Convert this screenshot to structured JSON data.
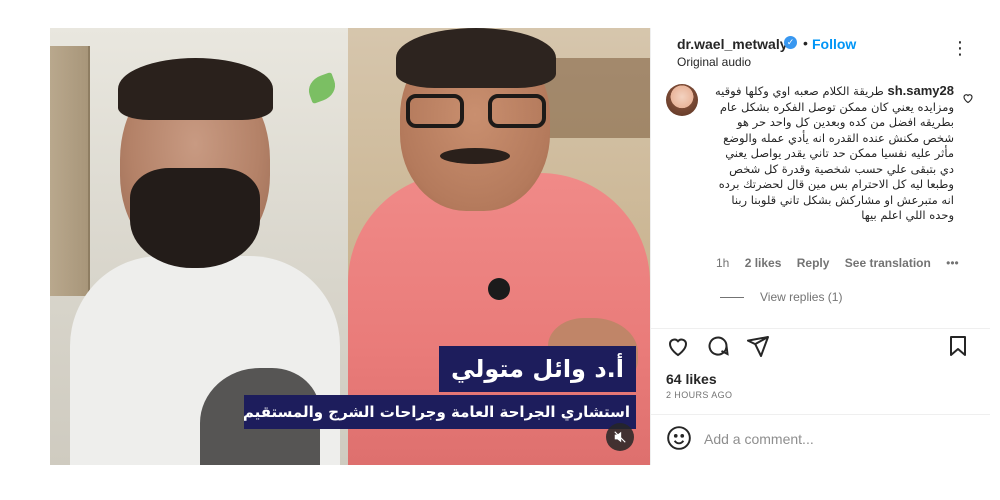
{
  "media": {
    "caption_name": "أ.د وائل متولي",
    "caption_title": "استشاري الجراحة العامة وجراحات الشرج والمستقيم بالليزر",
    "mute_icon": "speaker-muted-icon"
  },
  "header": {
    "username": "dr.wael_metwaly",
    "verified_icon": "verified-badge-icon",
    "separator": "•",
    "follow_label": "Follow",
    "audio_label": "Original audio",
    "more_icon": "more-horizontal-icon",
    "more_glyph": "⋮"
  },
  "comment": {
    "username": "sh.samy28",
    "text": "طريقة الكلام صعبه اوي وكلها فوقيه ومزايده يعني كان ممكن توصل الفكره بشكل عام بطريقه افضل من كده وبعدين كل واحد حر هو شخص مكنش عنده القدره انه يأدي عمله والوضع مأثر عليه نفسيا ممكن حد تاني يقدر يواصل يعني دي بتبقى علي حسب شخصية وقدرة كل شخص وطبعا ليه كل الاحترام بس مين قال لحضرتك برده انه متبرعش او مشاركش بشكل تاني قلوبنا ربنا وحده اللي اعلم بيها",
    "time": "1h",
    "likes": "2 likes",
    "reply": "Reply",
    "translate": "See translation",
    "more": "•••",
    "view_replies": "View replies (1)",
    "heart_icon": "heart-outline-icon"
  },
  "actions": {
    "like_icon": "heart-icon",
    "comment_icon": "comment-bubble-icon",
    "share_icon": "paper-plane-icon",
    "save_icon": "bookmark-icon"
  },
  "stats": {
    "likes": "64 likes",
    "time_ago": "2 HOURS AGO"
  },
  "add_comment": {
    "placeholder": "Add a comment...",
    "emoji_icon": "smiley-icon"
  },
  "colors": {
    "accent": "#0095f6",
    "verified": "#3897f0",
    "caption_bg": "#1d1d5c",
    "shirt_pink": "#e97b79"
  }
}
